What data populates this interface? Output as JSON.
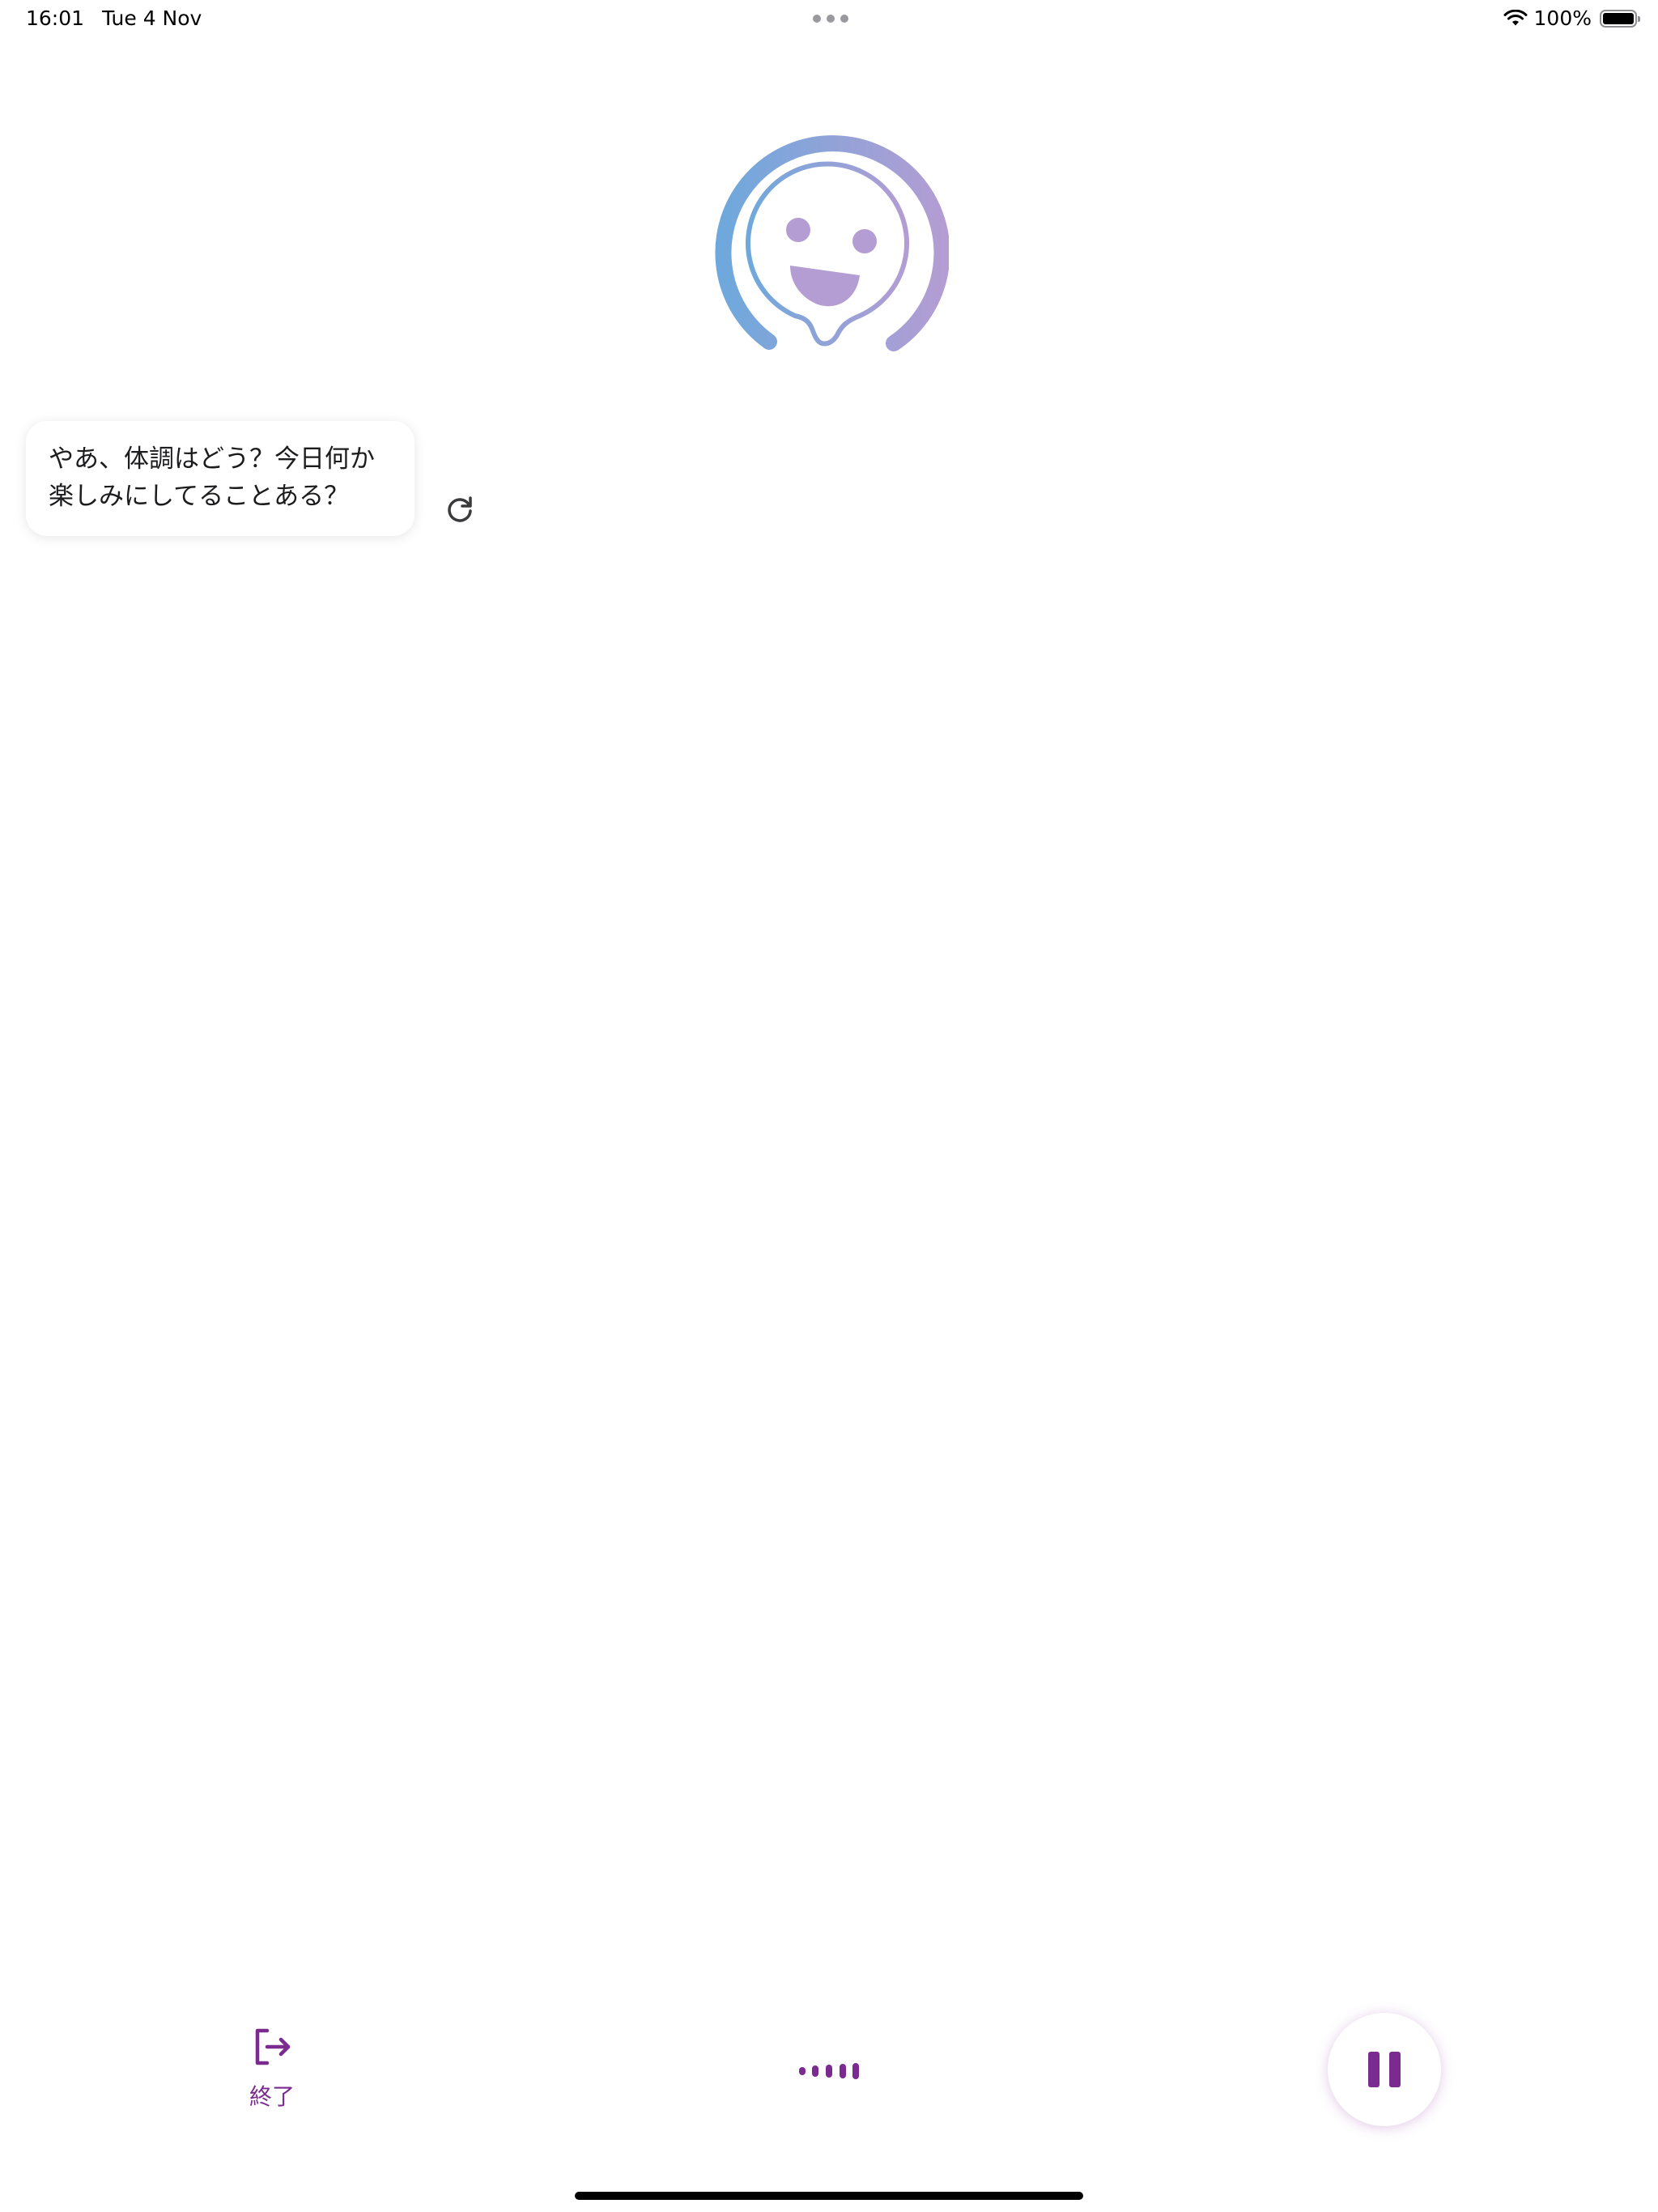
{
  "status_bar": {
    "time": "16:01",
    "date": "Tue 4 Nov",
    "battery_percent": "100%",
    "battery_level": 1.0
  },
  "mascot": {
    "icon": "smiling-mascot-logo",
    "gradient_colors": [
      "#6fa8dc",
      "#b39dd3"
    ]
  },
  "chat": {
    "message": "やあ、体調はどう？今日何か楽しみにしてることある？",
    "refresh_icon": "refresh-icon"
  },
  "controls": {
    "end_label": "終了",
    "end_icon": "exit-icon",
    "wave_icon": "audio-wave-icon",
    "pause_icon": "pause-icon",
    "accent_color": "#7b2a8f"
  }
}
